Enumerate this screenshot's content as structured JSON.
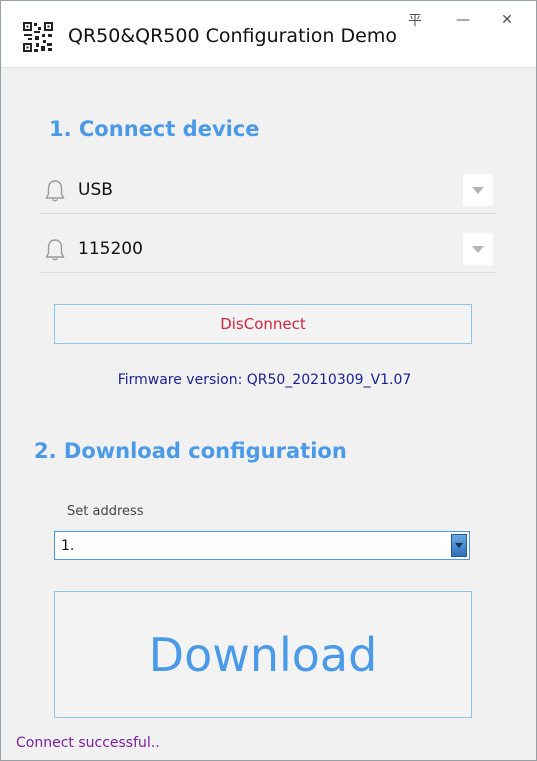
{
  "window": {
    "title": "QR50&QR500 Configuration Demo",
    "controls": {
      "pin": "平",
      "minimize": "—",
      "close": "✕"
    }
  },
  "section1": {
    "title": "1. Connect device",
    "port": {
      "value": "USB",
      "icon": "bell-icon"
    },
    "baud": {
      "value": "115200",
      "icon": "bell-icon"
    },
    "disconnect_label": "DisConnect",
    "firmware": "Firmware version: QR50_20210309_V1.07"
  },
  "section2": {
    "title": "2. Download configuration",
    "address_label": "Set address",
    "address_value": "1.",
    "download_label": "Download"
  },
  "status": "Connect successful..",
  "colors": {
    "accent": "#4a9ae8",
    "disconnect_text": "#d0243e",
    "firmware_text": "#1a1f8f",
    "status_text": "#7a1fa2"
  }
}
